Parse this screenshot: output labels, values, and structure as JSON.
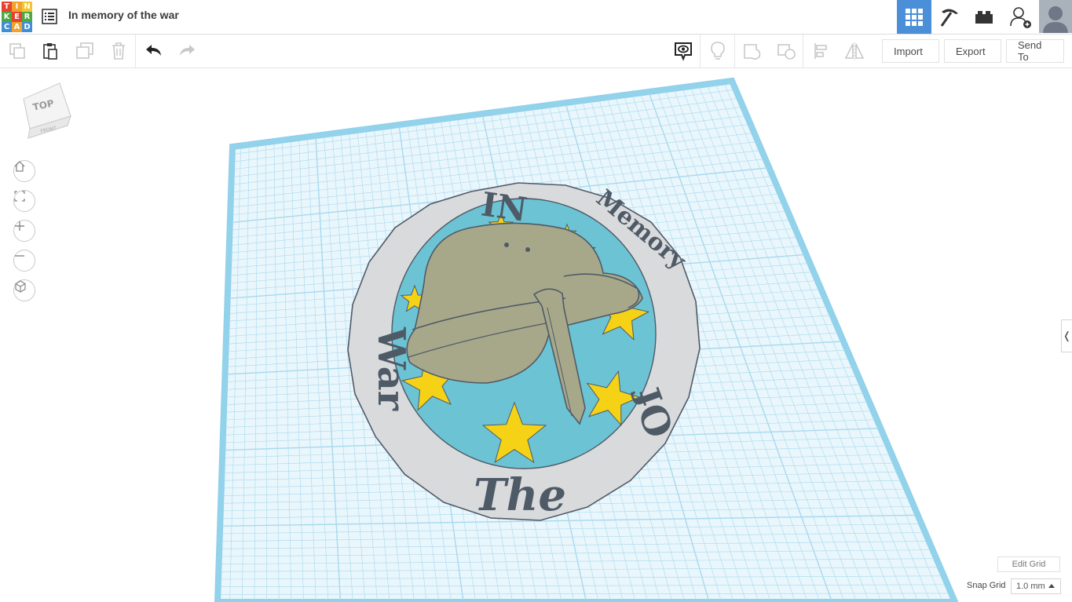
{
  "app": {
    "logo_letters": [
      "T",
      "I",
      "N",
      "K",
      "E",
      "R",
      "C",
      "A",
      "D"
    ],
    "logo_colors": [
      "#e8412f",
      "#f2a12c",
      "#f2c531",
      "#4fa941",
      "#e8412f",
      "#4fa941",
      "#3d8fd6",
      "#f2a12c",
      "#3d8fd6"
    ],
    "doc_title": "In memory of the war",
    "accent": "#4b8fd8"
  },
  "header": {
    "buttons": [
      {
        "name": "3d-design-view",
        "icon": "grid-icon",
        "active": true
      },
      {
        "name": "codeblocks-view",
        "icon": "pickaxe-icon",
        "active": false
      },
      {
        "name": "lego-view",
        "icon": "brick-icon",
        "active": false
      },
      {
        "name": "invite-user",
        "icon": "add-user-icon",
        "active": false
      }
    ]
  },
  "toolbar": {
    "import_label": "Import",
    "export_label": "Export",
    "send_to_label": "Send To"
  },
  "viewcube": {
    "top_label": "TOP",
    "front_label": "FRONT"
  },
  "model": {
    "words": [
      "IN",
      "Memory",
      "Of",
      "The",
      "War"
    ],
    "ring_color": "#d9dadc",
    "inner_color": "#6cc3d3",
    "helmet_color": "#a7a88a",
    "star_color": "#f5d216",
    "text_color": "#4f5a67"
  },
  "workplane": {
    "grid_color": "#a8d9ee",
    "edit_grid_label": "Edit Grid",
    "snap_grid_label": "Snap Grid",
    "snap_grid_value": "1.0 mm"
  }
}
